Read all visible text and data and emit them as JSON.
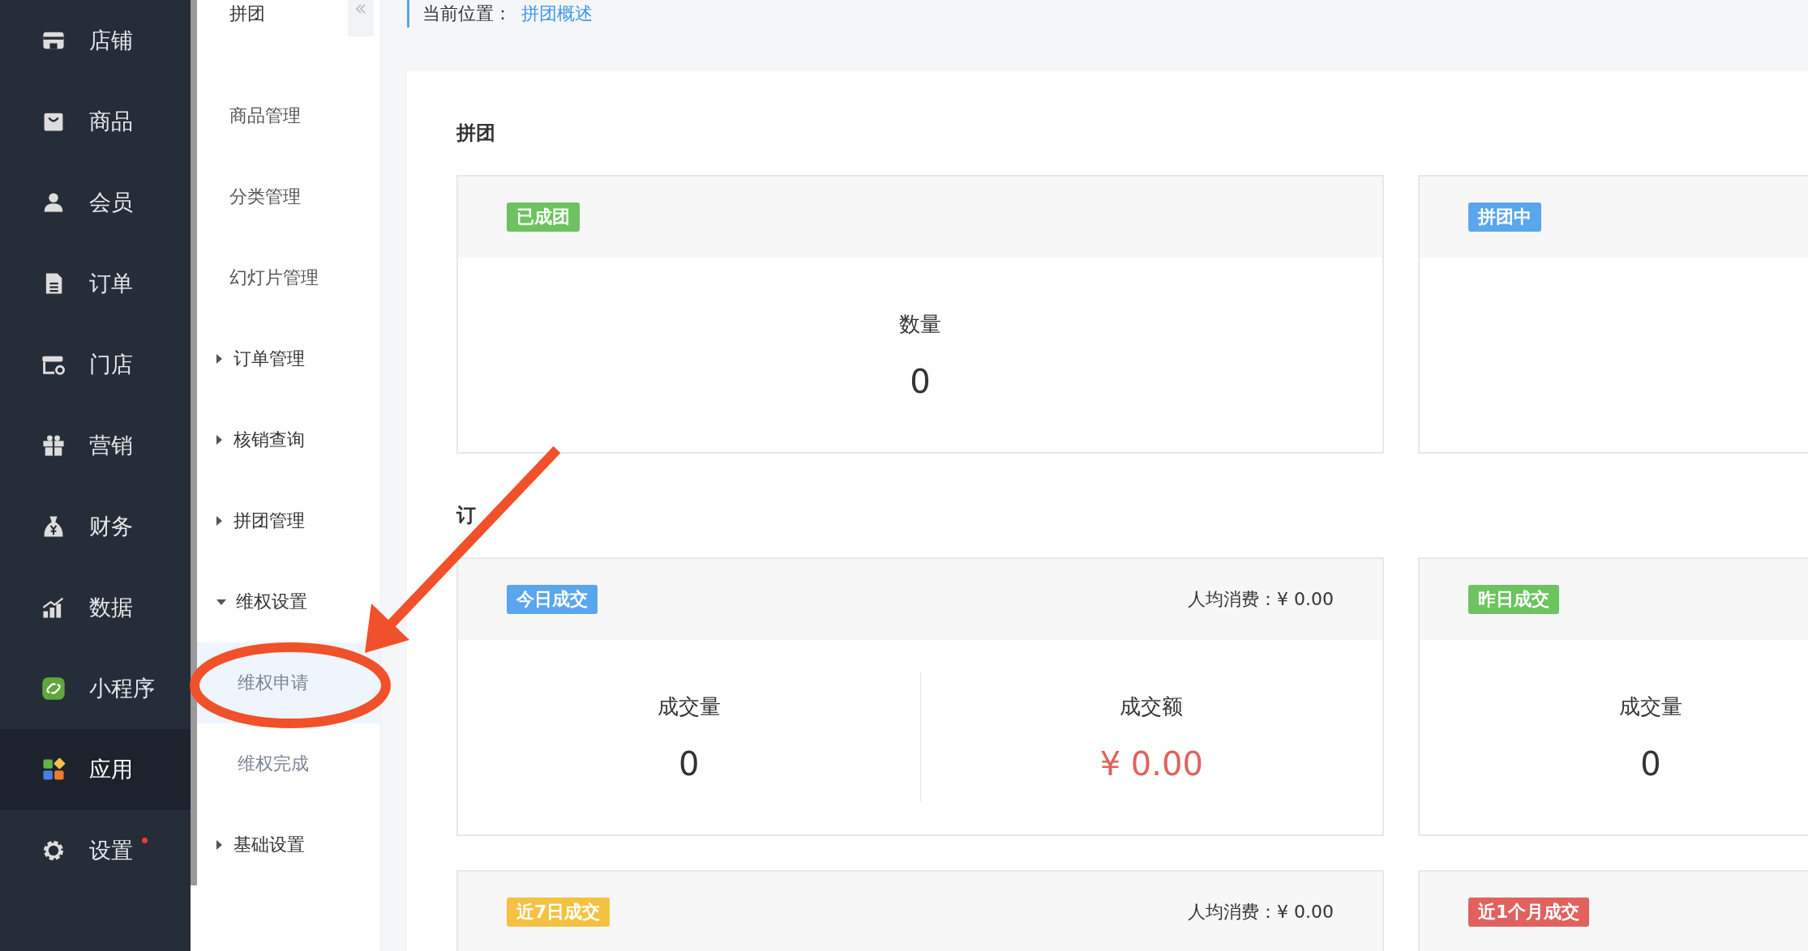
{
  "nav": {
    "items": [
      {
        "label": "店铺",
        "selected": false,
        "dot": false
      },
      {
        "label": "商品",
        "selected": false,
        "dot": false
      },
      {
        "label": "会员",
        "selected": false,
        "dot": false
      },
      {
        "label": "订单",
        "selected": false,
        "dot": false
      },
      {
        "label": "门店",
        "selected": false,
        "dot": false
      },
      {
        "label": "营销",
        "selected": false,
        "dot": false
      },
      {
        "label": "财务",
        "selected": false,
        "dot": false
      },
      {
        "label": "数据",
        "selected": false,
        "dot": false
      },
      {
        "label": "小程序",
        "selected": false,
        "dot": false
      },
      {
        "label": "应用",
        "selected": true,
        "dot": false
      },
      {
        "label": "设置",
        "selected": false,
        "dot": true
      }
    ]
  },
  "submenu": {
    "title": "拼团",
    "items": [
      {
        "kind": "link",
        "label": "商品管理"
      },
      {
        "kind": "link",
        "label": "分类管理"
      },
      {
        "kind": "link",
        "label": "幻灯片管理"
      },
      {
        "kind": "group",
        "label": "订单管理",
        "expanded": false
      },
      {
        "kind": "group",
        "label": "核销查询",
        "expanded": false
      },
      {
        "kind": "group",
        "label": "拼团管理",
        "expanded": false
      },
      {
        "kind": "group",
        "label": "维权设置",
        "expanded": true,
        "children": [
          {
            "label": "维权申请",
            "selected": true
          },
          {
            "label": "维权完成",
            "selected": false
          }
        ]
      },
      {
        "kind": "group",
        "label": "基础设置",
        "expanded": false
      }
    ]
  },
  "breadcrumb": {
    "label": "当前位置：",
    "current": "拼团概述"
  },
  "sections": [
    {
      "title": "拼团",
      "cards": [
        {
          "badge": "已成团",
          "color": "#6cc35f",
          "metrics": [
            {
              "kind": "count",
              "label": "数量",
              "value": "0"
            }
          ]
        },
        {
          "badge": "拼团中",
          "color": "#5aa6ee"
        }
      ]
    },
    {
      "title": "订",
      "cards": [
        {
          "badge": "今日成交",
          "color": "#5aa6ee",
          "avg": "人均消费：¥ 0.00",
          "metrics": [
            {
              "kind": "count",
              "label": "成交量",
              "value": "0"
            },
            {
              "kind": "amount",
              "label": "成交额",
              "value": "¥ 0.00"
            }
          ]
        },
        {
          "badge": "昨日成交",
          "color": "#6cc35f",
          "metrics": [
            {
              "kind": "count",
              "label": "成交量",
              "value": "0"
            }
          ]
        },
        {
          "badge": "近7日成交",
          "color": "#f5c142",
          "avg": "人均消费：¥ 0.00"
        },
        {
          "badge": "近1个月成交",
          "color": "#e0625f"
        }
      ]
    }
  ]
}
